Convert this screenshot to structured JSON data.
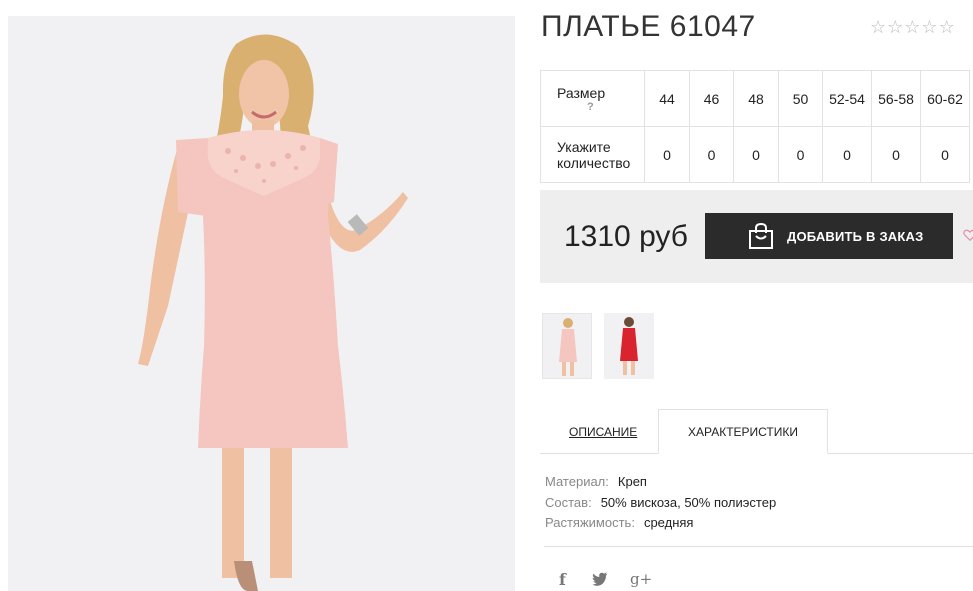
{
  "product": {
    "title": "ПЛАТЬЕ 61047",
    "stars": [
      "☆",
      "☆",
      "☆",
      "☆",
      "☆"
    ],
    "rating_count": ""
  },
  "size_table": {
    "size_label": "Размер",
    "help_mark": "?",
    "qty_label_line1": "Укажите",
    "qty_label_line2": "количество",
    "sizes": [
      "44",
      "46",
      "48",
      "50",
      "52-54",
      "56-58",
      "60-62"
    ],
    "quantities": [
      "0",
      "0",
      "0",
      "0",
      "0",
      "0",
      "0"
    ]
  },
  "order": {
    "price": "1310 руб",
    "add_button_label": "ДОБАВИТЬ В ЗАКАЗ"
  },
  "tabs": {
    "description": "ОПИСАНИЕ",
    "characteristics": "ХАРАКТЕРИСТИКИ"
  },
  "specs": [
    {
      "key": "Материал:",
      "value": "Креп"
    },
    {
      "key": "Состав:",
      "value": "50% вискоза, 50% полиэстер"
    },
    {
      "key": "Растяжимость:",
      "value": "средняя"
    }
  ],
  "social": {
    "facebook_glyph": "f",
    "twitter_glyph": "🐦",
    "gplus_glyph": "g+"
  },
  "colors": {
    "accent_dark": "#2b2b2b",
    "dress_pink": "#f4c6bf",
    "dress_red": "#d9232e",
    "heart_pink": "#e88aa6"
  }
}
